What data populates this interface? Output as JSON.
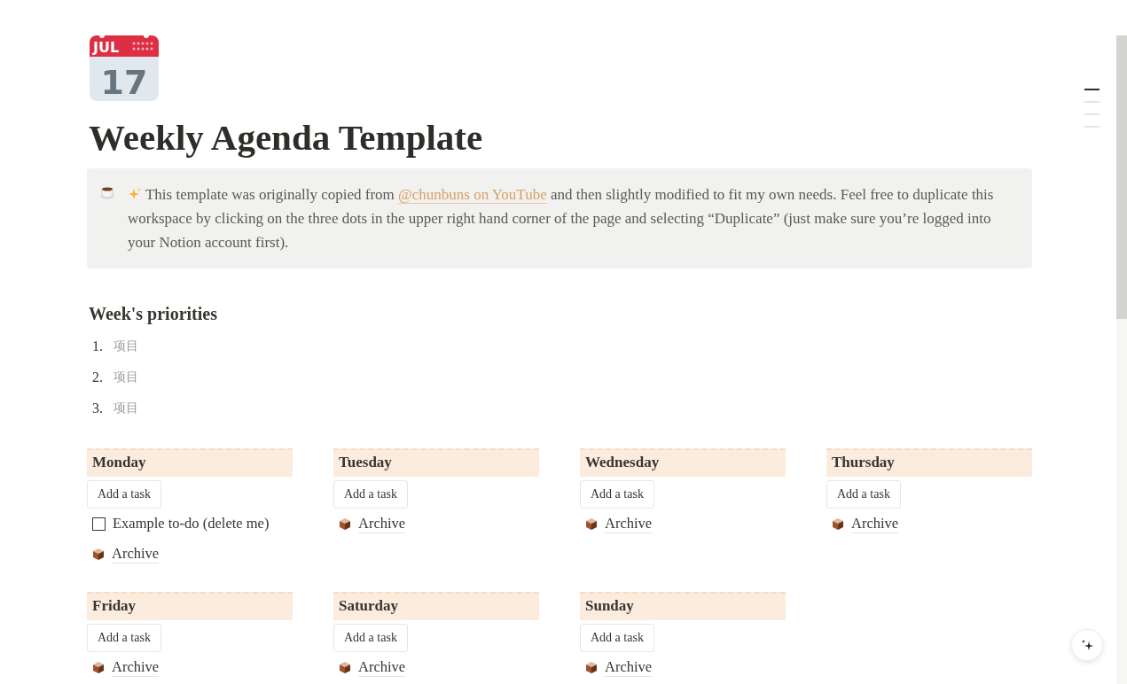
{
  "page_icon": {
    "month": "JUL",
    "day": "17"
  },
  "title": "Weekly Agenda Template",
  "callout": {
    "before": "This template was originally copied from ",
    "link": "@chunbuns on YouTube",
    "after": " and then slightly modified to fit my own needs. Feel free to duplicate this workspace by clicking on the three dots in the upper right hand corner of the page and selecting “Duplicate” (just make sure you’re logged into your Notion account first)."
  },
  "priorities": {
    "heading": "Week's priorities",
    "items": [
      {
        "number": "1.",
        "placeholder": "项目"
      },
      {
        "number": "2.",
        "placeholder": "项目"
      },
      {
        "number": "3.",
        "placeholder": "项目"
      }
    ]
  },
  "days": [
    {
      "name": "Monday",
      "button": "Add a task",
      "items": [
        {
          "kind": "todo",
          "label": "Example to-do (delete me)",
          "checked": false
        },
        {
          "kind": "archive",
          "label": "Archive"
        }
      ]
    },
    {
      "name": "Tuesday",
      "button": "Add a task",
      "items": [
        {
          "kind": "archive",
          "label": "Archive"
        }
      ]
    },
    {
      "name": "Wednesday",
      "button": "Add a task",
      "items": [
        {
          "kind": "archive",
          "label": "Archive"
        }
      ]
    },
    {
      "name": "Thursday",
      "button": "Add a task",
      "items": [
        {
          "kind": "archive",
          "label": "Archive"
        }
      ]
    },
    {
      "name": "Friday",
      "button": "Add a task",
      "items": [
        {
          "kind": "archive",
          "label": "Archive"
        }
      ]
    },
    {
      "name": "Saturday",
      "button": "Add a task",
      "items": [
        {
          "kind": "archive",
          "label": "Archive"
        }
      ]
    },
    {
      "name": "Sunday",
      "button": "Add a task",
      "items": [
        {
          "kind": "archive",
          "label": "Archive"
        }
      ]
    }
  ],
  "toc": [
    {
      "selected": true
    },
    {
      "selected": false
    },
    {
      "selected": false
    },
    {
      "selected": false
    }
  ]
}
